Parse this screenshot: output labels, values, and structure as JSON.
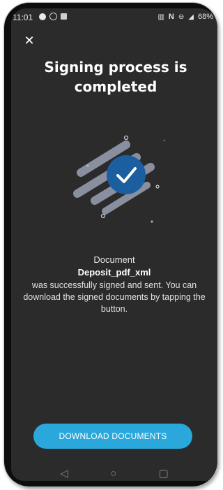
{
  "status_bar": {
    "time": "11:01",
    "battery": "68%",
    "icons": [
      "whatsapp-icon",
      "image-icon",
      "signal-icon",
      "nfc-icon",
      "dnd-icon",
      "mobile-data-icon"
    ]
  },
  "header": {
    "close_icon": "close-icon",
    "title": "Signing process is completed"
  },
  "illustration": {
    "icon": "checkmark-icon",
    "circle_color": "#1b5fa0",
    "stripe_color": "#8a8fa0"
  },
  "content": {
    "document_label": "Document",
    "document_name": "Deposit_pdf_xml",
    "message": "was successfully signed and sent. You can download the signed documents by tapping the button."
  },
  "actions": {
    "download_label": "DOWNLOAD DOCUMENTS",
    "button_color": "#2aa8dc"
  },
  "navigation": {
    "back_icon": "back-triangle-icon",
    "home_icon": "home-circle-icon",
    "recents_icon": "recents-square-icon"
  }
}
